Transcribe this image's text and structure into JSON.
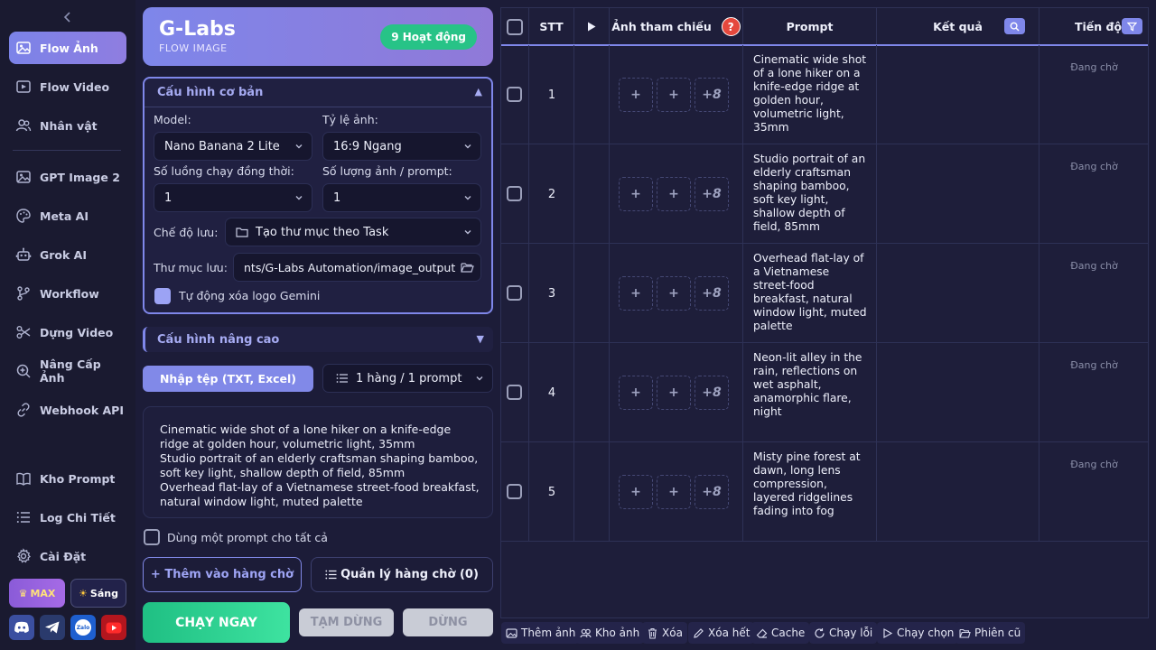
{
  "sidebar": {
    "items": [
      {
        "label": "Flow Ảnh",
        "icon": "image-icon"
      },
      {
        "label": "Flow Video",
        "icon": "video-icon"
      },
      {
        "label": "Nhân vật",
        "icon": "users-icon"
      },
      {
        "label": "GPT Image 2",
        "icon": "image-icon"
      },
      {
        "label": "Meta AI",
        "icon": "palette-icon"
      },
      {
        "label": "Grok AI",
        "icon": "robot-icon"
      },
      {
        "label": "Workflow",
        "icon": "branch-icon"
      },
      {
        "label": "Dựng Video",
        "icon": "scissors-icon"
      },
      {
        "label": "Nâng Cấp Ảnh",
        "icon": "zoom-icon"
      },
      {
        "label": "Webhook API",
        "icon": "link-icon"
      },
      {
        "label": "Kho Prompt",
        "icon": "book-icon"
      },
      {
        "label": "Log Chi Tiết",
        "icon": "list-icon"
      },
      {
        "label": "Cài Đặt",
        "icon": "gear-icon"
      }
    ],
    "plan_label": "MAX",
    "theme_label": "Sáng"
  },
  "header": {
    "brand": "G-Labs",
    "subtitle": "FLOW IMAGE",
    "active_badge": "9 Hoạt động"
  },
  "config": {
    "title": "Cấu hình cơ bản",
    "model_label": "Model:",
    "model_value": "Nano Banana 2 Lite",
    "ratio_label": "Tỷ lệ ảnh:",
    "ratio_value": "16:9 Ngang",
    "threads_label": "Số luồng chạy đồng thời:",
    "threads_value": "1",
    "count_label": "Số lượng ảnh / prompt:",
    "count_value": "1",
    "save_mode_label": "Chế độ lưu:",
    "save_mode_value": "Tạo thư mục theo Task",
    "folder_label": "Thư mục lưu:",
    "folder_value": "nts/G-Labs Automation/image_output",
    "auto_remove_label": "Tự động xóa logo Gemini"
  },
  "advanced": {
    "title": "Cấu hình nâng cao"
  },
  "import": {
    "button_label": "Nhập tệp (TXT, Excel)",
    "mode_value": "1 hàng / 1 prompt"
  },
  "prompt_text": "Cinematic wide shot of a lone hiker on a knife-edge\nridge at golden hour, volumetric light, 35mm\nStudio portrait of an elderly craftsman shaping bamboo,\nsoft key light, shallow depth of field, 85mm\nOverhead flat-lay of a Vietnamese street-food breakfast,\nnatural window light, muted palette",
  "same_prompt_label": "Dùng một prompt cho tất cả",
  "actions": {
    "add_queue": "+ Thêm vào hàng chờ",
    "manage_queue": "Quản lý hàng chờ (0)",
    "run": "CHẠY NGAY",
    "pause": "TẠM DỪNG",
    "stop": "DỪNG"
  },
  "table": {
    "headers": {
      "stt": "STT",
      "ref": "Ảnh tham chiếu",
      "prompt": "Prompt",
      "result": "Kết quả",
      "progress": "Tiến độ"
    },
    "slot_plus": "+",
    "slot_more": "+8",
    "rows": [
      {
        "stt": "1",
        "prompt": "Cinematic wide shot of a lone hiker on a knife-edge ridge at golden hour, volumetric light, 35mm",
        "status": "Đang chờ"
      },
      {
        "stt": "2",
        "prompt": "Studio portrait of an elderly craftsman shaping bamboo, soft key light, shallow depth of field, 85mm",
        "status": "Đang chờ"
      },
      {
        "stt": "3",
        "prompt": "Overhead flat-lay of a Vietnamese street-food breakfast, natural window light, muted palette",
        "status": "Đang chờ"
      },
      {
        "stt": "4",
        "prompt": "Neon-lit alley in the rain, reflections on wet asphalt, anamorphic flare, night",
        "status": "Đang chờ"
      },
      {
        "stt": "5",
        "prompt": "Misty pine forest at dawn, long lens compression, layered ridgelines fading into fog",
        "status": "Đang chờ"
      }
    ]
  },
  "toolbar": {
    "add_image": "Thêm ảnh",
    "library": "Kho ảnh",
    "delete": "Xóa",
    "delete_all": "Xóa hết",
    "cache": "Cache",
    "retry": "Chạy lỗi",
    "run_selected": "Chạy chọn",
    "old_session": "Phiên cũ"
  },
  "colors": {
    "accent": "#7f87ea",
    "success": "#27c387",
    "danger": "#e5483d",
    "background": "#1c1c38"
  }
}
